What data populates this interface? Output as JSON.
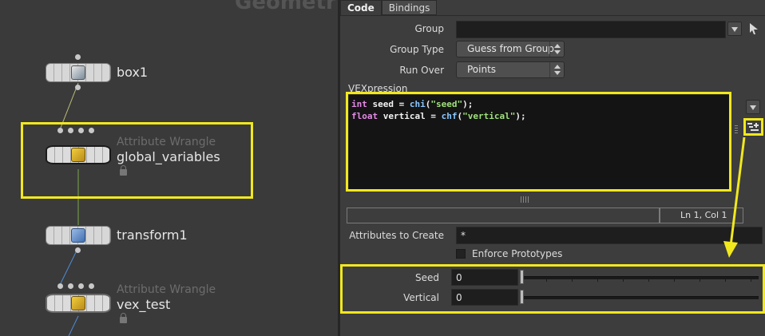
{
  "network": {
    "title": "Geometry",
    "nodes": {
      "box1": {
        "name": "box1",
        "type": ""
      },
      "global_variables": {
        "name": "global_variables",
        "type": "Attribute Wrangle"
      },
      "transform1": {
        "name": "transform1",
        "type": ""
      },
      "vex_test": {
        "name": "vex_test",
        "type": "Attribute Wrangle"
      }
    }
  },
  "panel": {
    "tabs": [
      "Code",
      "Bindings"
    ],
    "active_tab": "Code",
    "group_label": "Group",
    "group_value": "",
    "group_type_label": "Group Type",
    "group_type_value": "Guess from Group",
    "run_over_label": "Run Over",
    "run_over_value": "Points",
    "vexpression_label": "VEXpression",
    "code_lines": [
      "int seed = chi(\"seed\");",
      "float vertical = chf(\"vertical\");"
    ],
    "status_position": "Ln 1, Col 1",
    "attributes_to_create_label": "Attributes to Create",
    "attributes_to_create_value": "*",
    "enforce_prototypes_label": "Enforce Prototypes",
    "enforce_prototypes_checked": false,
    "seed_label": "Seed",
    "seed_value": "0",
    "vertical_label": "Vertical",
    "vertical_value": "0"
  },
  "icons": {
    "pin": "pin-icon",
    "create_spare_parms": "create-spare-parameters-icon",
    "menu_arrow": "chevron-down-icon"
  },
  "colors": {
    "highlight": "#f1e81e",
    "keyword": "#e48ae6",
    "function": "#88c7ff",
    "string": "#9fe27a"
  }
}
